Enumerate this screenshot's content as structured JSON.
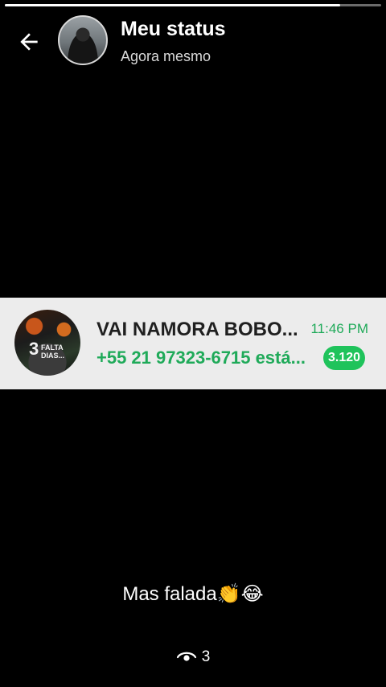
{
  "story_progress": 0.89,
  "header": {
    "title": "Meu status",
    "subtitle": "Agora mesmo",
    "back_icon": "arrow-left-icon"
  },
  "notification": {
    "title": "VAI NAMORA BOBO...",
    "time": "11:46 PM",
    "message": "+55 21 97323-6715 está...",
    "unread_count": "3.120",
    "avatar_text": {
      "number": "3",
      "line1": "FALTA",
      "line2": "DIAS..."
    },
    "accent_color": "#1faa59"
  },
  "caption": {
    "text": "Mas falada👏😂"
  },
  "views": {
    "icon": "eye-icon",
    "count": "3"
  }
}
